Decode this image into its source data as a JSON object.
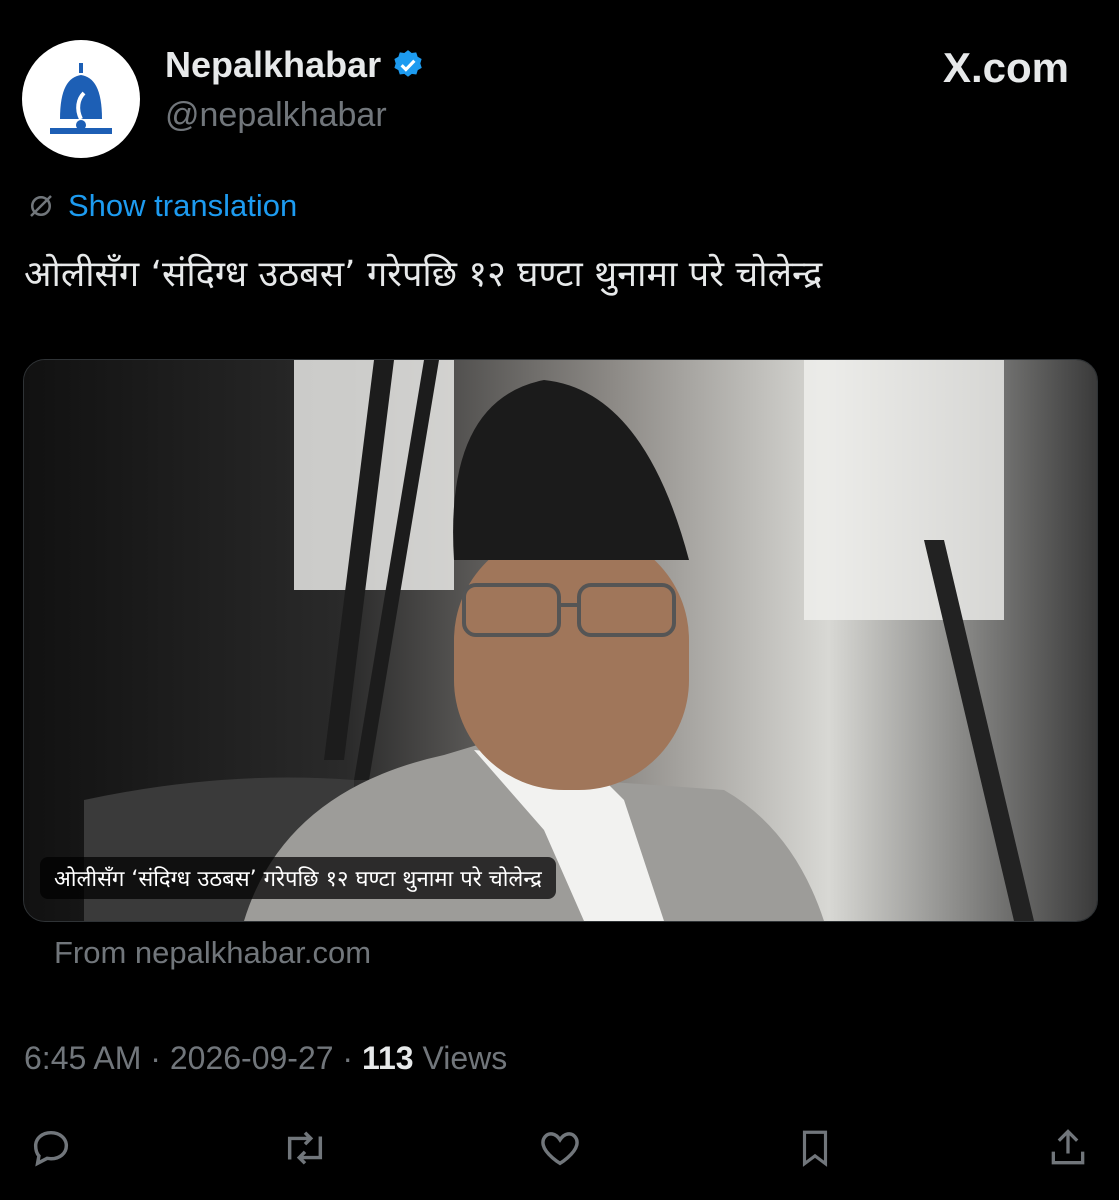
{
  "account": {
    "name": "Nepalkhabar",
    "handle": "@nepalkhabar",
    "verified_icon": "verified-badge-icon"
  },
  "brand": {
    "site": "X.com"
  },
  "translation": {
    "label": "Show translation",
    "icon": "globe-slash-icon"
  },
  "tweet": {
    "text": "ओलीसँग ‘संदिग्ध उठबस’ गरेपछि १२ घण्टा थुनामा परे चोलेन्द्र"
  },
  "card": {
    "caption": "ओलीसँग ‘संदिग्ध उठबस’ गरेपछि १२ घण्टा थुनामा परे चोलेन्द्र",
    "source": "From nepalkhabar.com"
  },
  "meta": {
    "time": "6:45 AM",
    "sep1": "·",
    "date": "2026-09-27",
    "sep2": "·",
    "views_count": "113",
    "views_label": "Views"
  },
  "actions": [
    "reply-icon",
    "repost-icon",
    "like-icon",
    "bookmark-icon",
    "share-icon"
  ],
  "colors": {
    "accent": "#1d9bf0",
    "muted": "#71767b",
    "text": "#e7e9ea",
    "background": "#000000"
  }
}
